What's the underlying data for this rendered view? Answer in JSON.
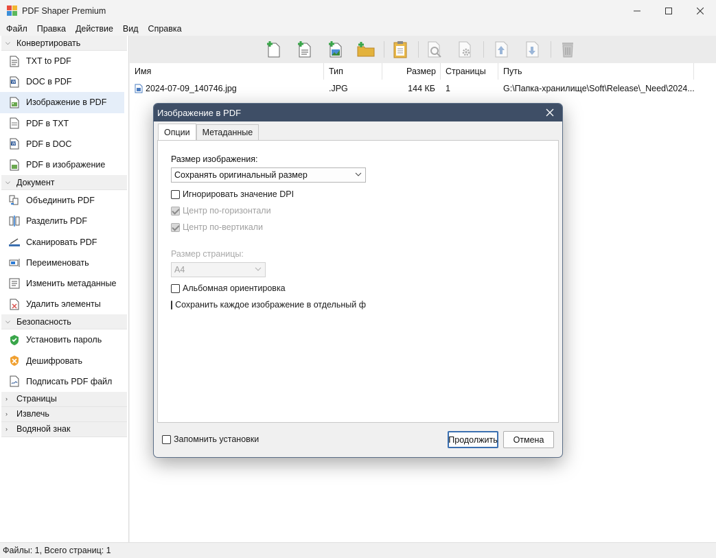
{
  "window": {
    "title": "PDF Shaper Premium"
  },
  "menu": [
    "Файл",
    "Правка",
    "Действие",
    "Вид",
    "Справка"
  ],
  "sidebar": {
    "groups": [
      {
        "label": "Конвертировать",
        "expanded": true,
        "items": [
          "TXT to PDF",
          "DOC в PDF",
          "Изображение в PDF",
          "PDF в TXT",
          "PDF в DOC",
          "PDF в изображение"
        ]
      },
      {
        "label": "Документ",
        "expanded": true,
        "items": [
          "Объединить PDF",
          "Разделить PDF",
          "Сканировать PDF",
          "Переименовать",
          "Изменить метаданные",
          "Удалить элементы"
        ]
      },
      {
        "label": "Безопасность",
        "expanded": true,
        "items": [
          "Установить пароль",
          "Дешифровать",
          "Подписать PDF файл"
        ]
      },
      {
        "label": "Страницы",
        "expanded": false,
        "items": []
      },
      {
        "label": "Извлечь",
        "expanded": false,
        "items": []
      },
      {
        "label": "Водяной знак",
        "expanded": false,
        "items": []
      }
    ],
    "selected": "Изображение в PDF"
  },
  "toolbar": {
    "buttons": [
      "add-file-icon",
      "add-document-icon",
      "add-image-icon",
      "add-folder-icon",
      "paste-icon",
      "preview-icon",
      "settings-icon",
      "move-up-icon",
      "move-down-icon",
      "delete-icon"
    ]
  },
  "filelist": {
    "columns": [
      "Имя",
      "Тип",
      "Размер",
      "Страницы",
      "Путь"
    ],
    "rows": [
      {
        "name": "2024-07-09_140746.jpg",
        "type": ".JPG",
        "size": "144 КБ",
        "pages": "1",
        "path": "G:\\Папка-хранилище\\Soft\\Release\\_Need\\2024..."
      }
    ]
  },
  "status": {
    "text": "Файлы: 1, Всего страниц: 1"
  },
  "dialog": {
    "title": "Изображение в PDF",
    "tabs": [
      "Опции",
      "Метаданные"
    ],
    "active_tab": "Опции",
    "image_size_label": "Размер изображения:",
    "image_size_value": "Сохранять оригинальный размер",
    "ignore_dpi": {
      "label": "Игнорировать значение DPI",
      "checked": false
    },
    "center_h": {
      "label": "Центр по-горизонтали",
      "checked": true,
      "disabled": true
    },
    "center_v": {
      "label": "Центр по-вертикали",
      "checked": true,
      "disabled": true
    },
    "page_size_label": "Размер страницы:",
    "page_size_value": "A4",
    "landscape": {
      "label": "Альбомная ориентировка",
      "checked": false
    },
    "separate_file": {
      "label": "Сохранить каждое изображение в отдельный ф",
      "checked": false
    },
    "remember": {
      "label": "Запомнить установки",
      "checked": false
    },
    "continue_label": "Продолжить",
    "cancel_label": "Отмена"
  }
}
